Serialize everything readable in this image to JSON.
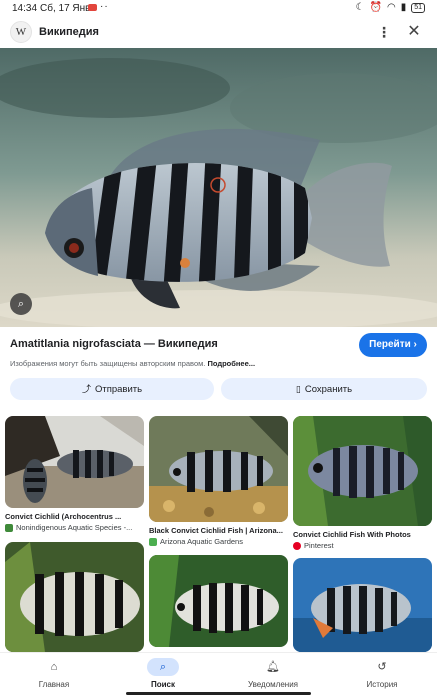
{
  "status_bar": {
    "time": "14:34",
    "date": "Сб, 17 Янв",
    "dots": "··",
    "battery": "51"
  },
  "header": {
    "logo": "W",
    "title": "Википедия",
    "menu_icon": "kebab-icon",
    "close_icon": "close-icon"
  },
  "result": {
    "title": "Amatitlania nigrofasciata — Википедия",
    "go_label": "Перейти",
    "copyright_note": "Изображения могут быть защищены авторским правом.",
    "more_link": "Подробнее..."
  },
  "actions": {
    "send_label": "Отправить",
    "save_label": "Сохранить"
  },
  "related": [
    {
      "caption": "Convict Cichlid (Archocentrus ...",
      "source": "Nonindigenous Aquatic Species -...",
      "source_color": "#3f8a3a"
    },
    {
      "caption": "Black Convict Cichlid Fish | Arizona...",
      "source": "Arizona Aquatic Gardens",
      "source_color": "#4caf50"
    },
    {
      "caption": "Convict Cichlid Fish With Photos",
      "source": "Pinterest",
      "source_color": "#e60023"
    },
    {
      "caption": "",
      "source": "",
      "source_color": ""
    },
    {
      "caption": "",
      "source": "",
      "source_color": ""
    },
    {
      "caption": "",
      "source": "",
      "source_color": ""
    }
  ],
  "nav": {
    "items": [
      {
        "label": "Главная",
        "icon": "home-icon"
      },
      {
        "label": "Поиск",
        "icon": "search-icon"
      },
      {
        "label": "Уведомления",
        "icon": "bell-icon"
      },
      {
        "label": "История",
        "icon": "history-icon"
      }
    ],
    "active_index": 1
  }
}
